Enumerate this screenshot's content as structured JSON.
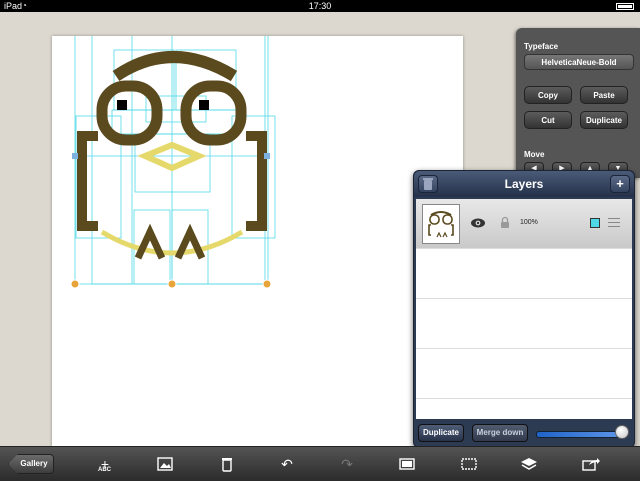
{
  "status_bar": {
    "carrier": "iPad",
    "time": "17:30"
  },
  "properties_panel": {
    "typeface_label": "Typeface",
    "typeface_value": "HelveticaNeue-Bold",
    "copy_label": "Copy",
    "paste_label": "Paste",
    "cut_label": "Cut",
    "duplicate_label": "Duplicate",
    "move_label": "Move"
  },
  "layers_panel": {
    "title": "Layers",
    "add_label": "+",
    "layers": [
      {
        "opacity": "100%",
        "visible": true,
        "locked": false,
        "selected": true
      }
    ],
    "duplicate_label": "Duplicate",
    "merge_down_label": "Merge down",
    "opacity_slider_value": 1.0
  },
  "toolbar": {
    "gallery_label": "Gallery",
    "add_text_label": "ABC",
    "icons": [
      "add-text-icon",
      "image-icon",
      "trash-icon",
      "undo-icon",
      "redo-icon",
      "canvas-icon",
      "crop-icon",
      "layers-icon",
      "export-icon"
    ]
  },
  "colors": {
    "owl_brown": "#5a4a1e",
    "owl_yellow": "#e6d96c",
    "guide_cyan": "#4fd9e6",
    "handle_orange": "#e8a43a"
  }
}
